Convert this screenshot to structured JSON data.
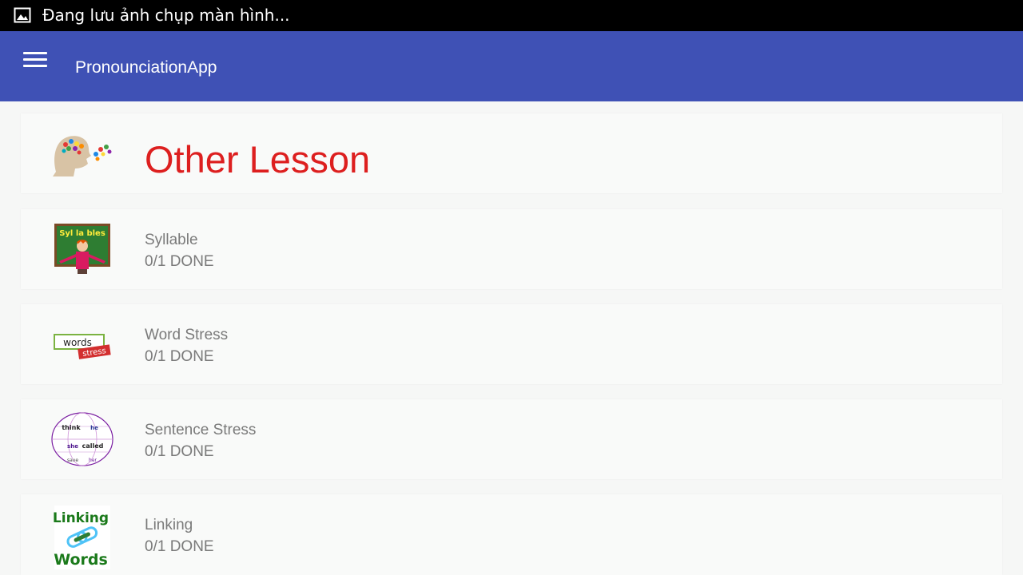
{
  "status_bar": {
    "icon": "image-icon",
    "text": "Đang lưu ảnh chụp màn hình..."
  },
  "app_bar": {
    "menu_icon": "hamburger-menu-icon",
    "title": "PronounciationApp",
    "background": "#3f51b5"
  },
  "section": {
    "icon": "head-speaking-icon",
    "title": "Other Lesson",
    "title_color": "#dd1f1f"
  },
  "lessons": [
    {
      "title": "Syllable",
      "status": "0/1 DONE",
      "icon": "syllables-chalkboard-icon",
      "icon_text": "Syl la bles"
    },
    {
      "title": "Word Stress",
      "status": "0/1 DONE",
      "icon": "word-stress-icon",
      "icon_text_1": "words",
      "icon_text_2": "stress"
    },
    {
      "title": "Sentence Stress",
      "status": "0/1 DONE",
      "icon": "sentence-stress-globe-icon",
      "icon_words": [
        "think",
        "he",
        "she",
        "called",
        "save",
        "her"
      ]
    },
    {
      "title": "Linking",
      "status": "0/1 DONE",
      "icon": "linking-words-chain-icon",
      "icon_text_1": "Linking",
      "icon_text_2": "Words"
    }
  ]
}
